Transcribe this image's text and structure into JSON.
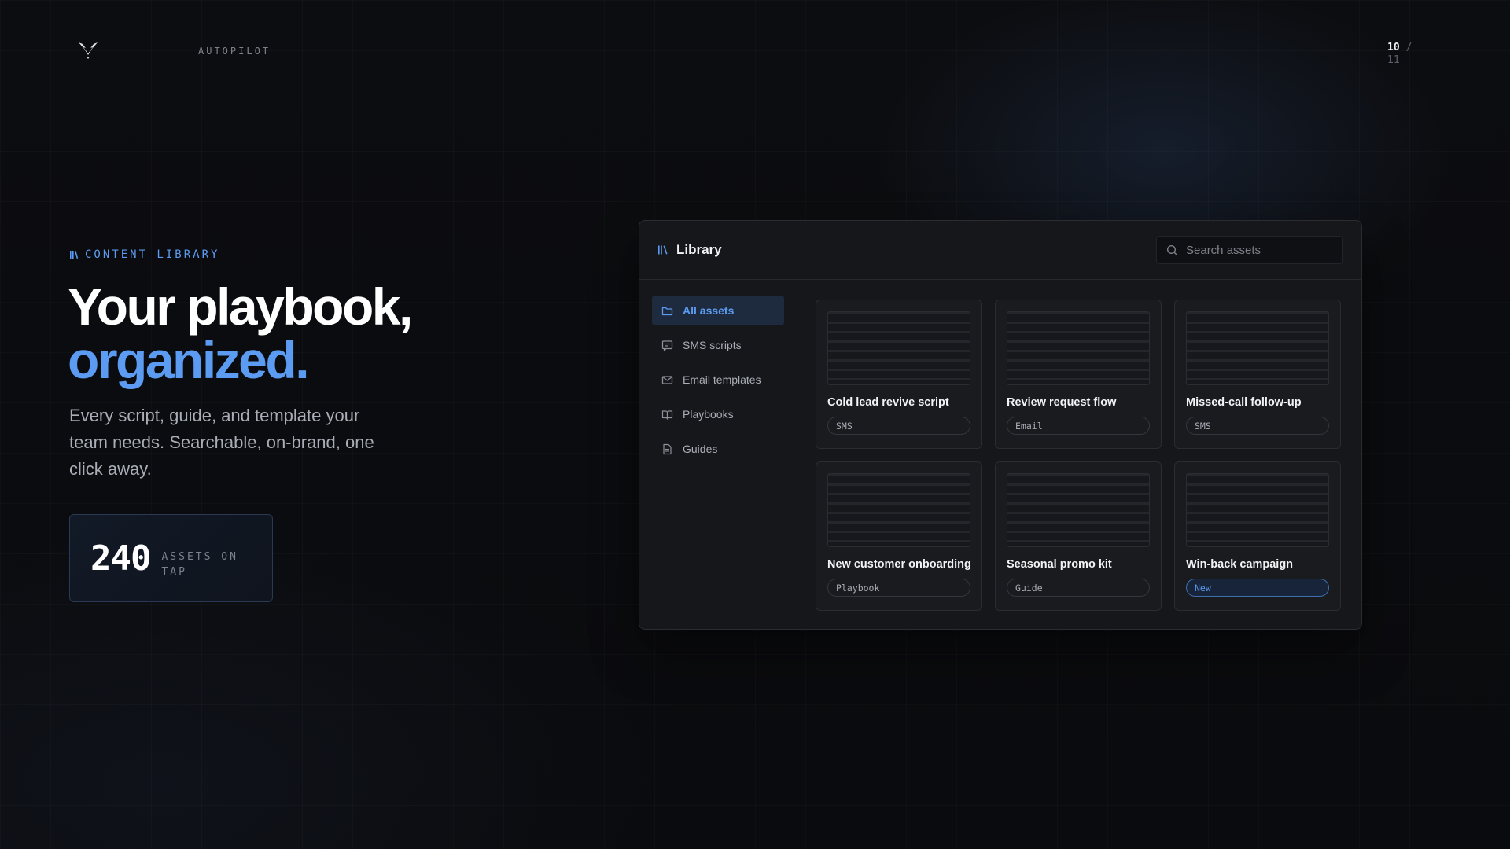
{
  "brand": {
    "logo_icon": "winged-logo-icon",
    "name": "AUTOPILOT"
  },
  "pager": {
    "current": "10",
    "separator": "/",
    "total": "11"
  },
  "hero": {
    "eyebrow": "CONTENT LIBRARY",
    "eyebrow_icon": "library-icon",
    "headline_line1": "Your playbook,",
    "headline_line2": "organized.",
    "subtitle": "Every script, guide, and template your team needs. Searchable, on-brand, one click away.",
    "stat_value": "240",
    "stat_label": "ASSETS ON TAP"
  },
  "colors": {
    "accent": "#5b9cf2",
    "background": "#0b0c0f",
    "panel": "#16171b"
  },
  "library": {
    "title": "Library",
    "search_placeholder": "Search assets",
    "nav": [
      {
        "label": "All assets",
        "icon": "folder-icon",
        "active": true
      },
      {
        "label": "SMS scripts",
        "icon": "message-icon",
        "active": false
      },
      {
        "label": "Email templates",
        "icon": "mail-icon",
        "active": false
      },
      {
        "label": "Playbooks",
        "icon": "book-icon",
        "active": false
      },
      {
        "label": "Guides",
        "icon": "document-icon",
        "active": false
      }
    ],
    "cards": [
      {
        "title": "Cold lead revive script",
        "tag": "SMS"
      },
      {
        "title": "Review request flow",
        "tag": "Email"
      },
      {
        "title": "Missed-call follow-up",
        "tag": "SMS"
      },
      {
        "title": "New customer onboarding",
        "tag": "Playbook"
      },
      {
        "title": "Seasonal promo kit",
        "tag": "Guide"
      },
      {
        "title": "Win-back campaign",
        "tag": "New"
      }
    ]
  }
}
